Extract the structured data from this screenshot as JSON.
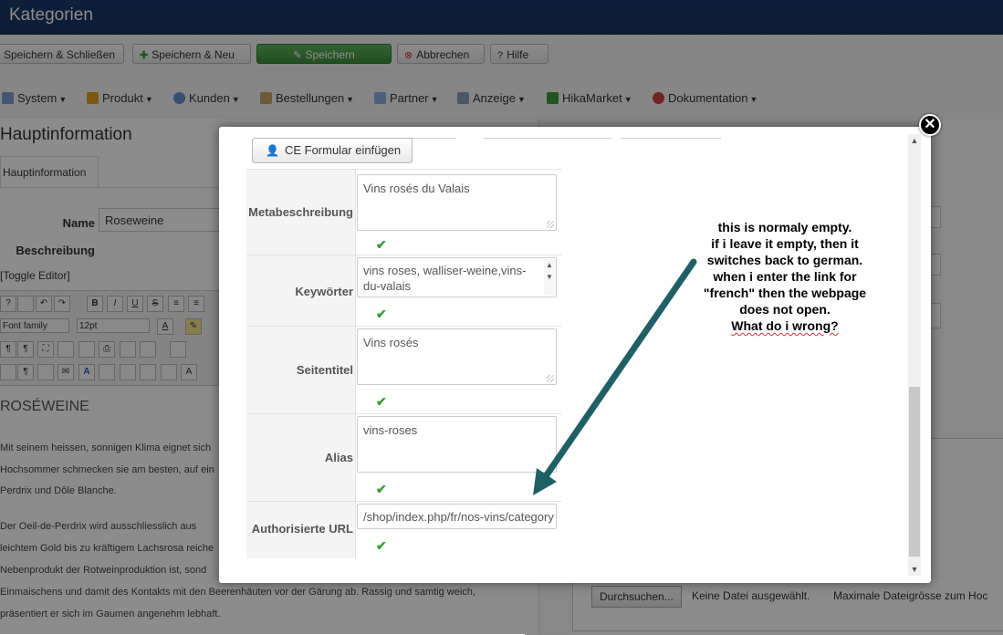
{
  "app": {
    "title": "Kategorien"
  },
  "toolbar": {
    "save_close": "Speichern & Schließen",
    "save_new": "Speichern & Neu",
    "save": "Speichern",
    "cancel": "Abbrechen",
    "help": "Hilfe"
  },
  "menu": {
    "items": [
      "System",
      "Produkt",
      "Kunden",
      "Bestellungen",
      "Partner",
      "Anzeige",
      "HikaMarket",
      "Dokumentation"
    ]
  },
  "background": {
    "heading": "Hauptinformation",
    "tab": "Hauptinformation",
    "name_label": "Name",
    "name_value": "Roseweine",
    "desc_label": "Beschreibung",
    "toggle_editor": "[Toggle Editor]",
    "font_family": "Font family",
    "font_size": "12pt",
    "editor_heading": "ROSÉWEINE",
    "editor_lines": [
      "Mit seinem heissen, sonnigen Klima eignet sich",
      "Hochsommer schmecken sie am besten, auf ein",
      "Perdrix und Dôle Blanche.",
      "Der Oeil-de-Perdrix wird ausschliesslich aus",
      "leichtem Gold bis zu kräftigem Lachsrosa reiche",
      "Nebenprodukt der Rotweinproduktion ist, sond",
      "Einmaischens und damit des Kontakts mit den Beerenhäuten vor der Gärung ab. Rassig und samtig weich,",
      "präsentiert er sich im Gaumen angenehm lebhaft."
    ],
    "browse_button": "Durchsuchen...",
    "no_file": "Keine Datei ausgewählt.",
    "max_size": "Maximale Dateigrösse zum Hoc"
  },
  "modal": {
    "ce_button": "CE Formular einfügen",
    "fields": [
      {
        "label": "Metabeschreibung",
        "value": "Vins rosés du Valais"
      },
      {
        "label": "Keywörter",
        "value": "vins roses, walliser-weine,vins-du-valais"
      },
      {
        "label": "Seitentitel",
        "value": "Vins rosés"
      },
      {
        "label": "Alias",
        "value": "vins-roses"
      },
      {
        "label": "Authorisierte URL",
        "value": "/shop/index.php/fr/nos-vins/category"
      }
    ],
    "check_glyph": "✔",
    "close_glyph": "✕"
  },
  "annotation": {
    "lines": [
      "this is normaly empty.",
      "if i leave it empty, then it",
      "switches back to german.",
      "when i enter the link for",
      "\"french\" then the webpage",
      "does not open.",
      "What do i wrong?"
    ]
  },
  "colors": {
    "title_bar": "#1a3a6b",
    "save_green": "#4ea64e",
    "check_green": "#3b9b3b",
    "arrow_teal": "#1f6065"
  }
}
